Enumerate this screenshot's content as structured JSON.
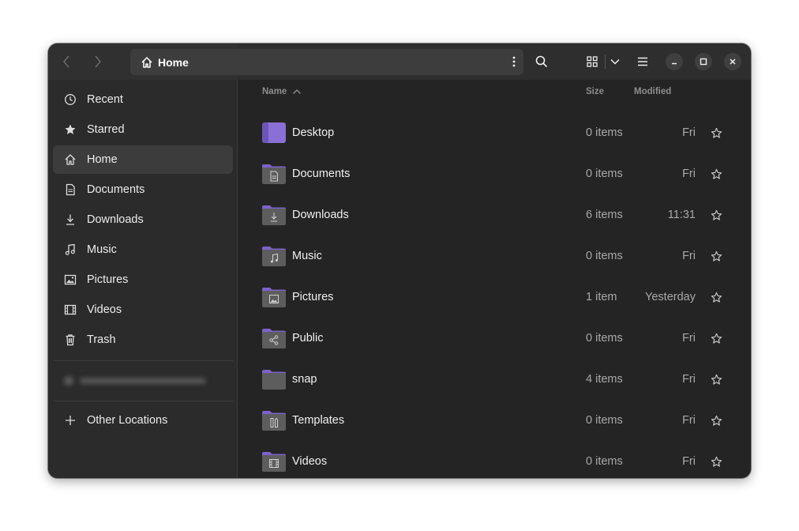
{
  "colors": {
    "folder_purple": "#7b63c9",
    "folder_body": "#5d5d5d",
    "desktop_purple": "#8a6fd6"
  },
  "header": {
    "path_label": "Home",
    "back_icon": "chevron-left-icon",
    "forward_icon": "chevron-right-icon",
    "search_icon": "search-icon",
    "view_icon": "grid-view-icon",
    "menu_icon": "hamburger-menu-icon"
  },
  "sidebar": {
    "items": [
      {
        "label": "Recent",
        "icon": "clock-icon",
        "active": false
      },
      {
        "label": "Starred",
        "icon": "star-icon",
        "active": false
      },
      {
        "label": "Home",
        "icon": "home-icon",
        "active": true
      },
      {
        "label": "Documents",
        "icon": "document-icon",
        "active": false
      },
      {
        "label": "Downloads",
        "icon": "download-icon",
        "active": false
      },
      {
        "label": "Music",
        "icon": "music-note-icon",
        "active": false
      },
      {
        "label": "Pictures",
        "icon": "picture-icon",
        "active": false
      },
      {
        "label": "Videos",
        "icon": "film-icon",
        "active": false
      },
      {
        "label": "Trash",
        "icon": "trash-icon",
        "active": false
      }
    ],
    "other_locations": "Other Locations"
  },
  "columns": {
    "name": "Name",
    "size": "Size",
    "modified": "Modified"
  },
  "files": [
    {
      "name": "Desktop",
      "size": "0 items",
      "modified": "Fri",
      "emblem": "desktop"
    },
    {
      "name": "Documents",
      "size": "0 items",
      "modified": "Fri",
      "emblem": "document"
    },
    {
      "name": "Downloads",
      "size": "6 items",
      "modified": "11:31",
      "emblem": "download"
    },
    {
      "name": "Music",
      "size": "0 items",
      "modified": "Fri",
      "emblem": "music"
    },
    {
      "name": "Pictures",
      "size": "1 item",
      "modified": "Yesterday",
      "emblem": "picture"
    },
    {
      "name": "Public",
      "size": "0 items",
      "modified": "Fri",
      "emblem": "share"
    },
    {
      "name": "snap",
      "size": "4 items",
      "modified": "Fri",
      "emblem": "none"
    },
    {
      "name": "Templates",
      "size": "0 items",
      "modified": "Fri",
      "emblem": "template"
    },
    {
      "name": "Videos",
      "size": "0 items",
      "modified": "Fri",
      "emblem": "film"
    }
  ]
}
